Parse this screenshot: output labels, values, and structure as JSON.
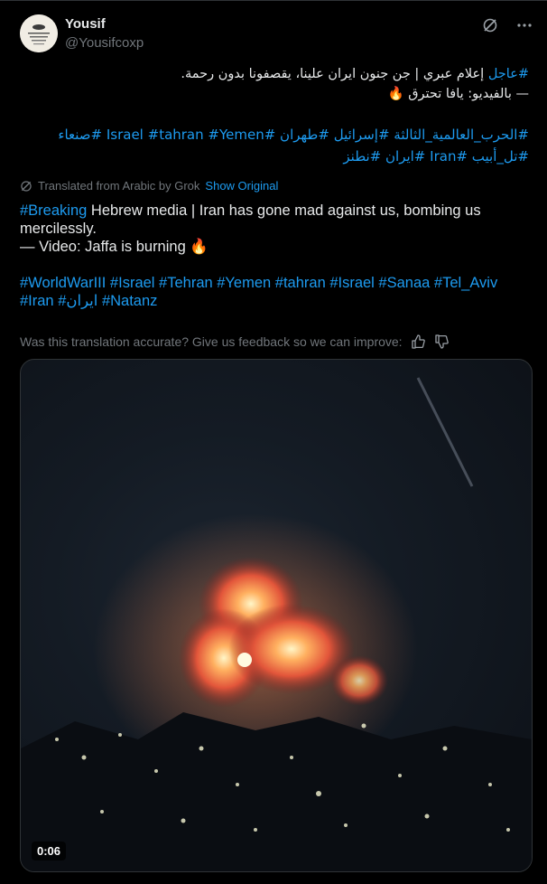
{
  "post": {
    "display_name": "Yousif",
    "handle": "@Yousifcoxp",
    "header_icons": [
      "grok-icon",
      "more-icon"
    ],
    "arabic": {
      "line1_link": "#عاجل",
      "line1_text": " إعلام عبري | جن جنون ايران علينا، يقصفونا بدون رحمة.",
      "line2_text": "— بالفيديو: يافا تحترق 🔥",
      "tags_line1": "#الحرب_العالمية_الثالثة #إسرائيل #طهران  #Israel  #tahran #Yemen  #صنعاء",
      "tags_line2": "#تل_أبيب  #Iran  #ايران #نطنز"
    },
    "translation_note": "Translated from Arabic by Grok",
    "show_original": "Show Original",
    "english": {
      "line1_link": "#Breaking",
      "line1_text": " Hebrew media | Iran has gone mad against us, bombing us",
      "line2_text": "mercilessly.",
      "line3_text": "— Video: Jaffa is burning 🔥",
      "tags_line1": "#WorldWarIII #Israel #Tehran #Yemen #tahran #Israel #Sanaa #Tel_Aviv",
      "tags_line2": "#Iran #ايران #Natanz"
    },
    "feedback_text": "Was this translation accurate? Give us feedback so we can improve:",
    "video": {
      "duration": "0:06"
    }
  },
  "colors": {
    "background": "#000000",
    "text": "#e7e9ea",
    "secondary": "#71767b",
    "link": "#1d9bf0"
  }
}
